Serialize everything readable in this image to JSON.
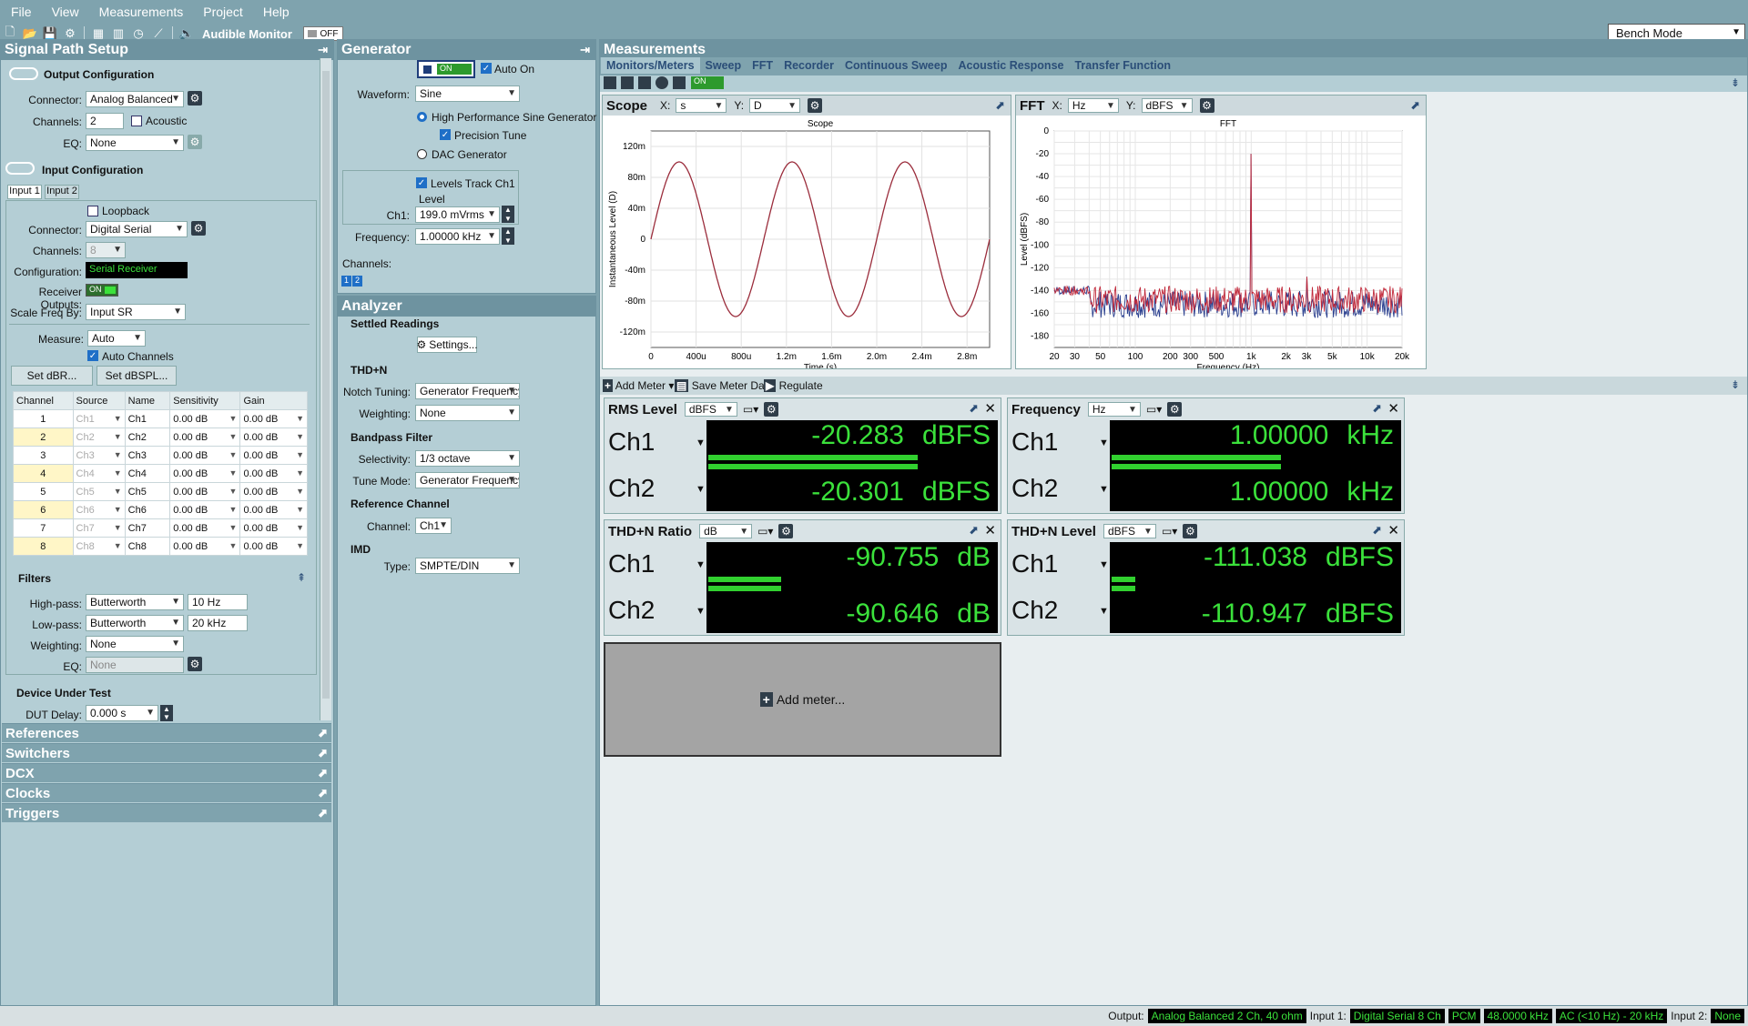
{
  "menu": [
    "File",
    "View",
    "Measurements",
    "Project",
    "Help"
  ],
  "toolbar": {
    "audible_monitor": "Audible Monitor",
    "off_label": "OFF"
  },
  "bench_mode": "Bench Mode",
  "signal_path": {
    "title": "Signal Path Setup",
    "output": {
      "header": "Output Configuration",
      "connector_label": "Connector:",
      "connector": "Analog Balanced",
      "channels_label": "Channels:",
      "channels": "2",
      "acoustic": "Acoustic",
      "eq_label": "EQ:",
      "eq": "None"
    },
    "input": {
      "header": "Input Configuration",
      "tab1": "Input 1",
      "tab2": "Input 2",
      "loopback": "Loopback",
      "connector_label": "Connector:",
      "connector": "Digital Serial",
      "channels_label": "Channels:",
      "channels": "8",
      "configuration_label": "Configuration:",
      "configuration": "Serial Receiver",
      "receiver_outputs_label": "Receiver Outputs:",
      "on_label": "ON",
      "scale_label": "Scale Freq By:",
      "scale": "Input SR",
      "measure_label": "Measure:",
      "measure": "Auto",
      "auto_channels": "Auto Channels",
      "set_dbr": "Set dBR...",
      "set_dbspl": "Set dBSPL..."
    },
    "table_headers": [
      "Channel",
      "Source",
      "Name",
      "Sensitivity",
      "Gain"
    ],
    "rows": [
      {
        "channel": "1",
        "source": "Ch1",
        "name": "Ch1",
        "sensitivity": "0.00 dB",
        "gain": "0.00 dB"
      },
      {
        "channel": "2",
        "source": "Ch2",
        "name": "Ch2",
        "sensitivity": "0.00 dB",
        "gain": "0.00 dB"
      },
      {
        "channel": "3",
        "source": "Ch3",
        "name": "Ch3",
        "sensitivity": "0.00 dB",
        "gain": "0.00 dB"
      },
      {
        "channel": "4",
        "source": "Ch4",
        "name": "Ch4",
        "sensitivity": "0.00 dB",
        "gain": "0.00 dB"
      },
      {
        "channel": "5",
        "source": "Ch5",
        "name": "Ch5",
        "sensitivity": "0.00 dB",
        "gain": "0.00 dB"
      },
      {
        "channel": "6",
        "source": "Ch6",
        "name": "Ch6",
        "sensitivity": "0.00 dB",
        "gain": "0.00 dB"
      },
      {
        "channel": "7",
        "source": "Ch7",
        "name": "Ch7",
        "sensitivity": "0.00 dB",
        "gain": "0.00 dB"
      },
      {
        "channel": "8",
        "source": "Ch8",
        "name": "Ch8",
        "sensitivity": "0.00 dB",
        "gain": "0.00 dB"
      }
    ],
    "filters": {
      "header": "Filters",
      "highpass_label": "High-pass:",
      "highpass": "Butterworth",
      "highpass_freq": "10 Hz",
      "lowpass_label": "Low-pass:",
      "lowpass": "Butterworth",
      "lowpass_freq": "20 kHz",
      "weighting_label": "Weighting:",
      "weighting": "None",
      "eq_label": "EQ:",
      "eq": "None"
    },
    "dut": {
      "header": "Device Under Test",
      "delay_label": "DUT Delay:",
      "delay": "0.000 s"
    },
    "accordions": [
      "References",
      "Switchers",
      "DCX",
      "Clocks",
      "Triggers"
    ]
  },
  "generator": {
    "title": "Generator",
    "on_label": "ON",
    "auto_on": "Auto On",
    "waveform_label": "Waveform:",
    "waveform": "Sine",
    "hp_sine": "High Performance Sine Generator",
    "precision_tune": "Precision Tune",
    "dac_gen": "DAC Generator",
    "levels_track": "Levels Track Ch1",
    "level_label": "Level",
    "ch1_label": "Ch1:",
    "ch1_level": "199.0 mVrms",
    "frequency_label": "Frequency:",
    "frequency": "1.00000 kHz",
    "channels_label": "Channels:",
    "ch_btn1": "1",
    "ch_btn2": "2"
  },
  "analyzer": {
    "title": "Analyzer",
    "settled": "Settled Readings",
    "settings_btn": "Settings...",
    "thdn": "THD+N",
    "notch_label": "Notch Tuning:",
    "notch": "Generator Frequency",
    "weighting_label": "Weighting:",
    "weighting": "None",
    "bandpass": "Bandpass Filter",
    "selectivity_label": "Selectivity:",
    "selectivity": "1/3 octave",
    "tune_label": "Tune Mode:",
    "tune": "Generator Frequency",
    "refch": "Reference Channel",
    "channel_label": "Channel:",
    "channel": "Ch1",
    "imd": "IMD",
    "type_label": "Type:",
    "type": "SMPTE/DIN"
  },
  "measurements": {
    "title": "Measurements",
    "tabs": [
      "Monitors/Meters",
      "Sweep",
      "FFT",
      "Recorder",
      "Continuous Sweep",
      "Acoustic Response",
      "Transfer Function"
    ],
    "on_label": "ON",
    "scope": {
      "title": "Scope",
      "x_label": "X:",
      "x": "s",
      "y_label": "Y:",
      "y": "D"
    },
    "fft": {
      "title": "FFT",
      "x_label": "X:",
      "x": "Hz",
      "y_label": "Y:",
      "y": "dBFS"
    },
    "add_meter": "Add Meter",
    "save_meter": "Save Meter Data",
    "regulate": "Regulate",
    "add_meter_big": "Add meter..."
  },
  "meters": [
    {
      "title": "RMS Level",
      "unit_sel": "dBFS",
      "ch1": "-20.283",
      "ch2": "-20.301",
      "unit": "dBFS",
      "ch1_fill": 0.72,
      "ch2_fill": 0.72
    },
    {
      "title": "Frequency",
      "unit_sel": "Hz",
      "ch1": "1.00000",
      "ch2": "1.00000",
      "unit": "kHz",
      "ch1_fill": 0.58,
      "ch2_fill": 0.58
    },
    {
      "title": "THD+N Ratio",
      "unit_sel": "dB",
      "ch1": "-90.755",
      "ch2": "-90.646",
      "unit": "dB",
      "ch1_fill": 0.25,
      "ch2_fill": 0.25
    },
    {
      "title": "THD+N Level",
      "unit_sel": "dBFS",
      "ch1": "-111.038",
      "ch2": "-110.947",
      "unit": "dBFS",
      "ch1_fill": 0.08,
      "ch2_fill": 0.08
    }
  ],
  "meter_ch": [
    "Ch1",
    "Ch2"
  ],
  "status": {
    "output_label": "Output:",
    "output": "Analog Balanced 2 Ch, 40 ohm",
    "input1_label": "Input 1:",
    "input1": "Digital Serial 8 Ch",
    "pcm": "PCM",
    "rate": "48.0000 kHz",
    "ac": "AC (<10 Hz) - 20 kHz",
    "input2_label": "Input 2:",
    "input2": "None"
  },
  "chart_data": [
    {
      "type": "line",
      "title": "Scope",
      "xlabel": "Time (s)",
      "ylabel": "Instantaneous Level (D)",
      "xlim": [
        0,
        0.003
      ],
      "ylim": [
        -140,
        140
      ],
      "x_ticks": [
        "0",
        "400u",
        "800u",
        "1.2m",
        "1.6m",
        "2.0m",
        "2.4m",
        "2.8m"
      ],
      "y_ticks": [
        "120m",
        "80m",
        "40m",
        "0",
        "-40m",
        "-80m",
        "-120m"
      ],
      "series": [
        {
          "amplitude": 0.1,
          "frequency_hz": 1000
        }
      ]
    },
    {
      "type": "line",
      "title": "FFT",
      "xlabel": "Frequency (Hz)",
      "ylabel": "Level (dBFS)",
      "xlim": [
        20,
        20000
      ],
      "ylim": [
        -190,
        0
      ],
      "xscale": "log",
      "x_ticks": [
        "20",
        "30",
        "50",
        "100",
        "200",
        "300",
        "500",
        "1k",
        "2k",
        "3k",
        "5k",
        "10k",
        "20k"
      ],
      "y_ticks": [
        "0",
        "-20",
        "-40",
        "-60",
        "-80",
        "-100",
        "-120",
        "-140",
        "-160",
        "-180"
      ],
      "peaks": [
        {
          "x": 1000,
          "y": -20
        }
      ],
      "noise_floor": -150
    }
  ]
}
